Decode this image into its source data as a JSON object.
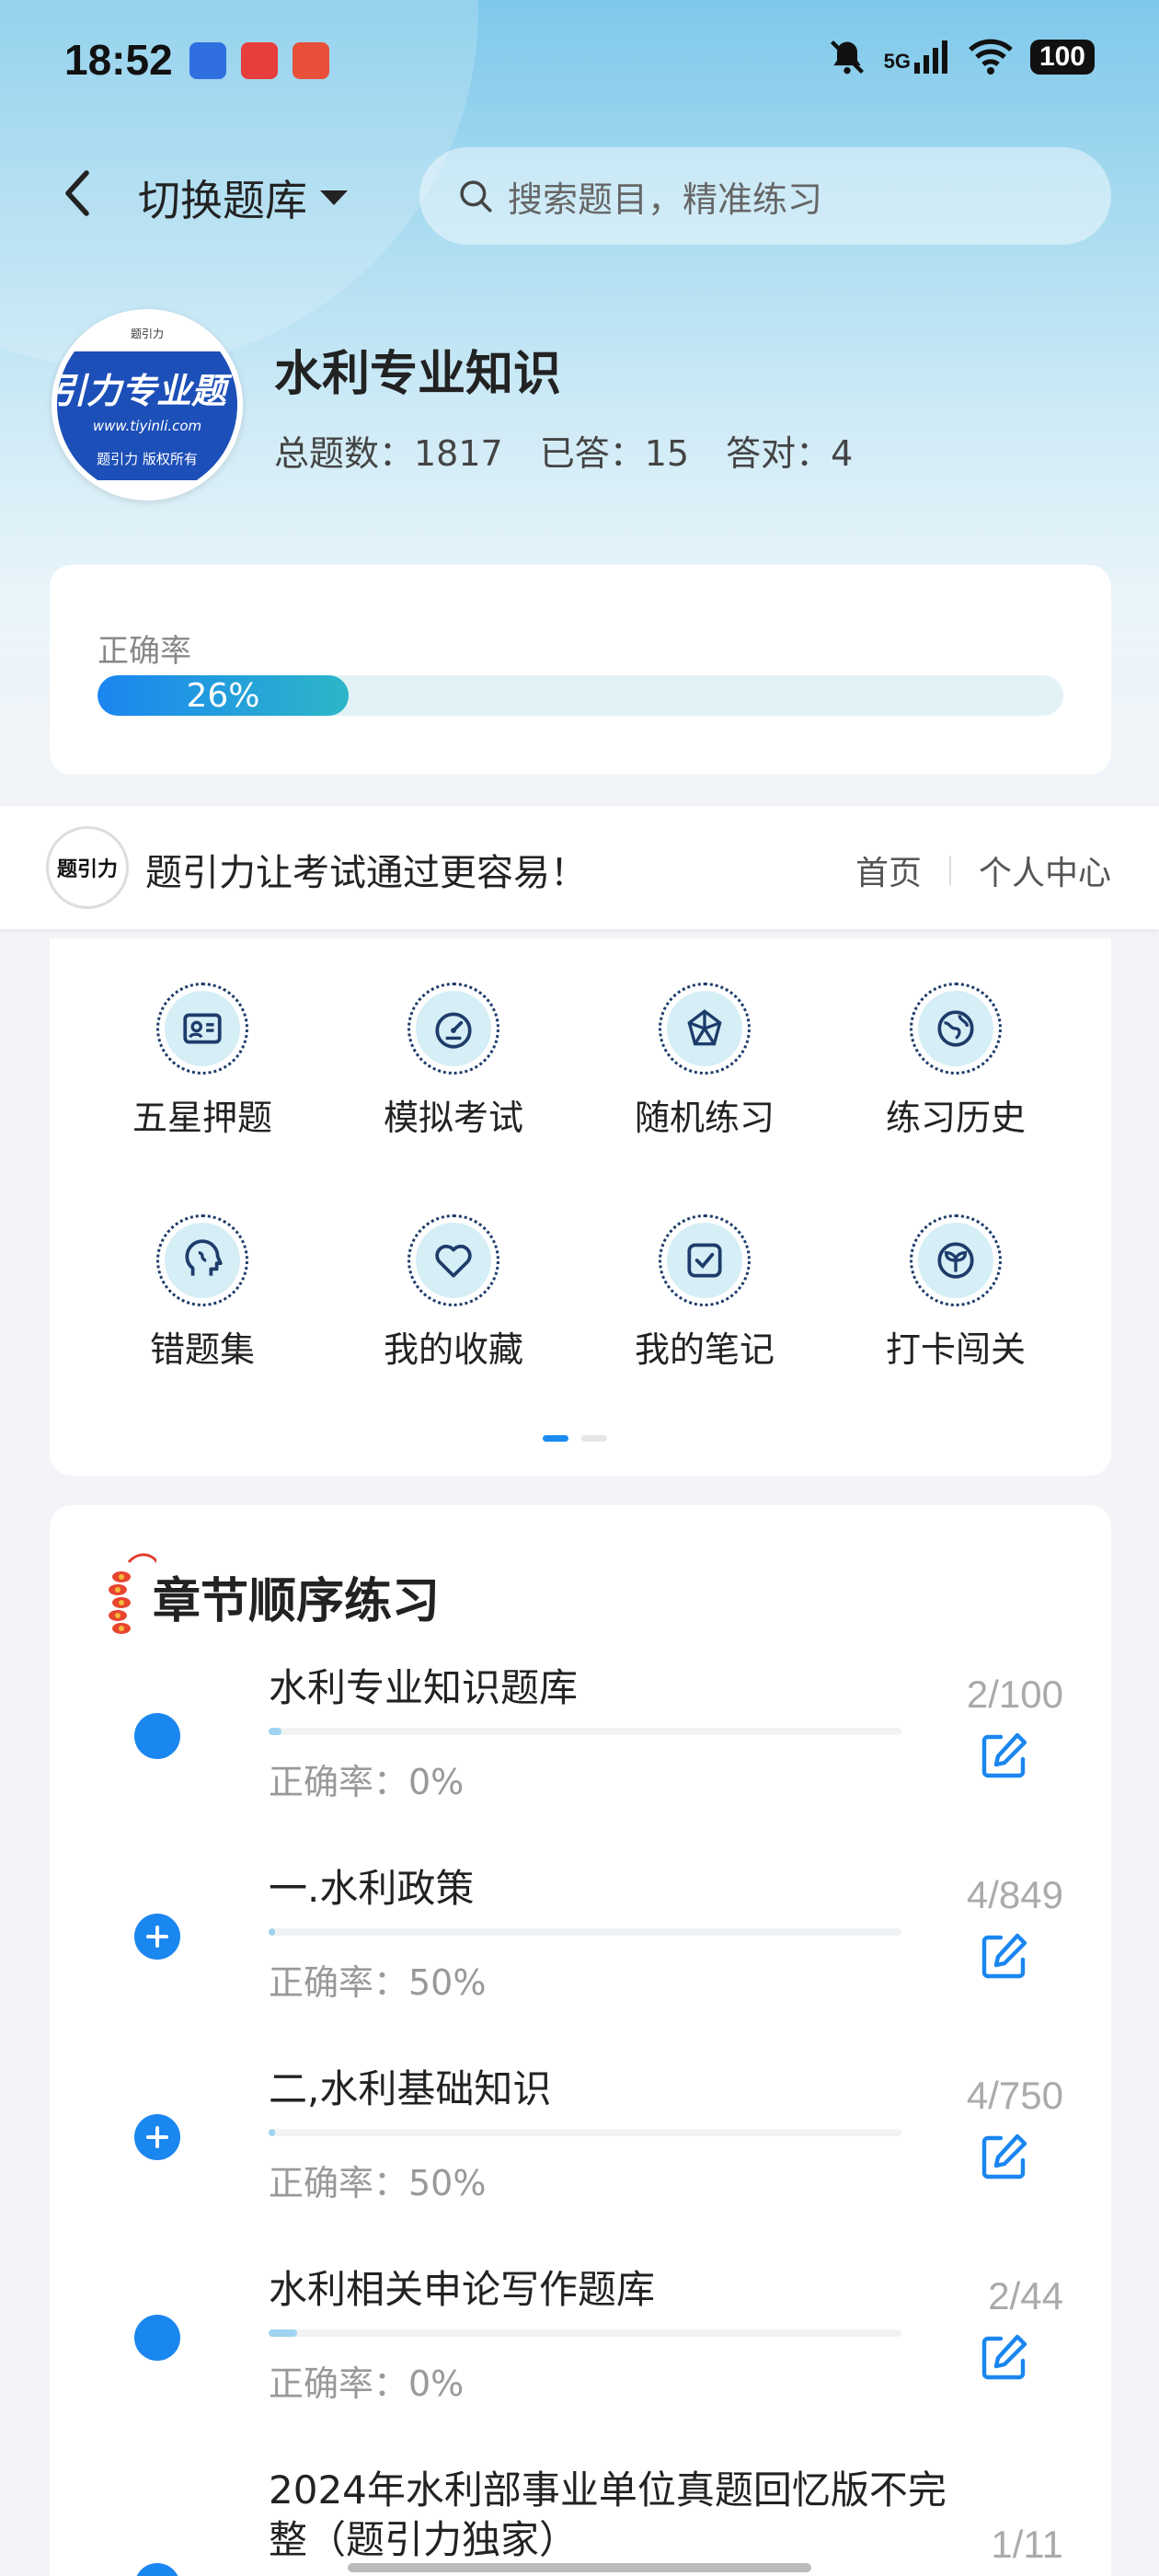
{
  "status_bar": {
    "time": "18:52",
    "network": "5G",
    "battery": "100"
  },
  "header": {
    "switch_label": "切换题库",
    "search_placeholder": "搜索题目，精准练习"
  },
  "bank": {
    "logo_text": "引力专业题",
    "logo_url": "www.tiyinli.com",
    "logo_owner": "题引力 版权所有",
    "logo_top": "题引力",
    "title": "水利专业知识",
    "total": "总题数：1817",
    "answered": "已答：15",
    "correct": "答对：4"
  },
  "accuracy": {
    "label": "正确率",
    "value_text": "26%",
    "value": 0.26
  },
  "banner": {
    "logo_text": "题引力",
    "slogan": "题引力让考试通过更容易！",
    "link_home": "首页",
    "link_profile": "个人中心"
  },
  "grid": {
    "items": [
      {
        "label": "五星押题",
        "icon": "id-card-icon"
      },
      {
        "label": "模拟考试",
        "icon": "speedometer-icon"
      },
      {
        "label": "随机练习",
        "icon": "network-icon"
      },
      {
        "label": "练习历史",
        "icon": "globe-icon"
      },
      {
        "label": "错题集",
        "icon": "head-icon"
      },
      {
        "label": "我的收藏",
        "icon": "heart-icon"
      },
      {
        "label": "我的笔记",
        "icon": "note-check-icon"
      },
      {
        "label": "打卡闯关",
        "icon": "leaf-icon"
      }
    ],
    "page_count": 2,
    "active_page": 1
  },
  "chapters": {
    "title": "章节顺序练习",
    "rows": [
      {
        "name": "水利专业知识题库",
        "accuracy": "正确率：0%",
        "count": "2/100",
        "progress": 0.02,
        "icon": "dot-icon"
      },
      {
        "name": "一.水利政策",
        "accuracy": "正确率：50%",
        "count": "4/849",
        "progress": 0.005,
        "icon": "plus-circle-icon"
      },
      {
        "name": "二,水利基础知识",
        "accuracy": "正确率：50%",
        "count": "4/750",
        "progress": 0.005,
        "icon": "plus-circle-icon"
      },
      {
        "name": "水利相关申论写作题库",
        "accuracy": "正确率：0%",
        "count": "2/44",
        "progress": 0.045,
        "icon": "dot-icon"
      },
      {
        "name": "2024年水利部事业单位真题回忆版不完整（题引力独家）",
        "accuracy": "",
        "count": "1/11",
        "progress": 0.09,
        "icon": "dot-icon"
      }
    ]
  },
  "colors": {
    "accent": "#1a86f0",
    "gradient_end": "#2cb6c8",
    "hero_top": "#7ec8ea"
  }
}
